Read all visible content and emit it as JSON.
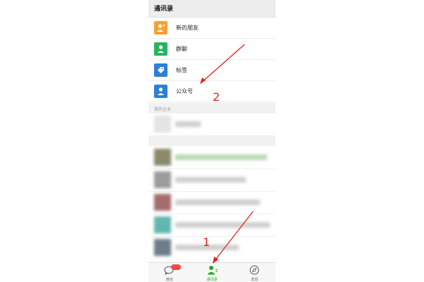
{
  "header": {
    "title": "通讯录"
  },
  "menu": [
    {
      "label": "新的朋友",
      "icon": "add-friend-icon",
      "color": "#f5a135"
    },
    {
      "label": "群聊",
      "icon": "group-chat-icon",
      "color": "#25b65e"
    },
    {
      "label": "标签",
      "icon": "tag-icon",
      "color": "#2f7fd6"
    },
    {
      "label": "公众号",
      "icon": "official-account-icon",
      "color": "#2f7fd6"
    }
  ],
  "sections": {
    "enterprise": "我的企业"
  },
  "tabs": [
    {
      "label": "微信",
      "icon": "chat-bubble-icon"
    },
    {
      "label": "通讯录",
      "icon": "contacts-icon",
      "active": true,
      "color": "#1aad19"
    },
    {
      "label": "发现",
      "icon": "compass-icon"
    }
  ],
  "annotations": {
    "step1": "1",
    "step2": "2"
  },
  "colors": {
    "accent": "#1aad19",
    "annotation": "#e02020"
  }
}
